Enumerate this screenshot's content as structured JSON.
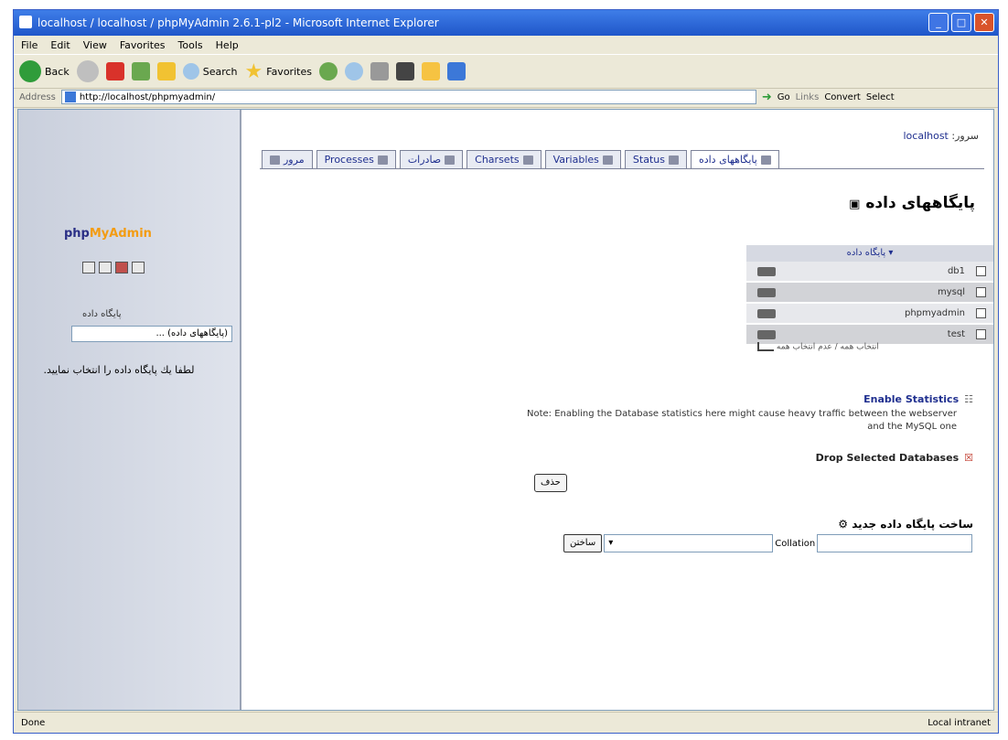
{
  "window": {
    "title": "localhost / localhost / phpMyAdmin 2.6.1-pl2 - Microsoft Internet Explorer"
  },
  "menu": [
    "File",
    "Edit",
    "View",
    "Favorites",
    "Tools",
    "Help"
  ],
  "toolbar": {
    "back": "Back",
    "search": "Search",
    "favorites": "Favorites"
  },
  "address": {
    "label": "Address",
    "url": "http://localhost/phpmyadmin/",
    "go": "Go",
    "links": "Links",
    "convert": "Convert",
    "select": "Select"
  },
  "left": {
    "logo_a": "php",
    "logo_b": "MyAdmin",
    "db_label": "پایگاه داده",
    "db_select": "(پایگاههای داده) ...",
    "hint": "لطفا یك پایگاه داده را انتخاب نمایید."
  },
  "server": {
    "label": "سرور:",
    "name": "localhost"
  },
  "tabs": [
    "مرور",
    "Processes",
    "صادرات",
    "Charsets",
    "Variables",
    "Status",
    "پایگاههای داده"
  ],
  "page_title": "پایگاههای داده",
  "db_table": {
    "header": "پایگاه داده",
    "rows": [
      "db1",
      "mysql",
      "phpmyadmin",
      "test"
    ]
  },
  "select_all": "انتخاب همه / عدم انتخاب همه",
  "enable_stats": "Enable Statistics",
  "note": "Note: Enabling the Database statistics here might cause heavy traffic between the webserver and the MySQL one",
  "drop_label": "Drop Selected Databases",
  "drop_button": "حذف",
  "create": {
    "title": "ساخت پایگاه داده جدید",
    "collation": "Collation",
    "button": "ساختن"
  },
  "status": {
    "left": "Done",
    "right": "Local intranet"
  }
}
